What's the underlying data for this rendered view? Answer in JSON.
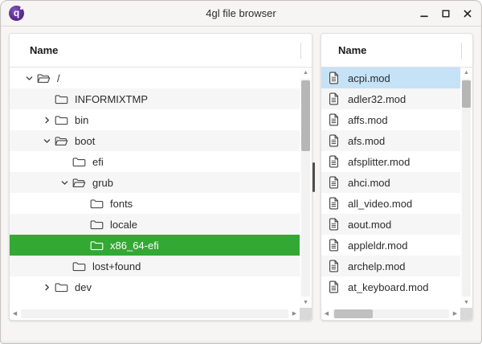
{
  "window": {
    "title": "4gl file browser",
    "icon_letter": "q",
    "controls": [
      "minimize",
      "maximize",
      "close"
    ]
  },
  "icons": {
    "up": "▲",
    "down": "▼",
    "left": "◀",
    "right": "▶",
    "names": [
      "app-logo-icon",
      "chevron-down-icon",
      "chevron-right-icon",
      "folder-closed-icon",
      "folder-open-icon",
      "file-document-icon",
      "minimize-icon",
      "maximize-icon",
      "close-icon",
      "scroll-up-icon",
      "scroll-down-icon",
      "scroll-left-icon",
      "scroll-right-icon"
    ]
  },
  "colors": {
    "tree_selection_green": "#34a834",
    "list_selection_blue": "#c5e2f7",
    "titlebar_bg": "#f6f5f4",
    "row_alt": "#f6f6f6",
    "app_icon_purple": "#5c2d91"
  },
  "left_panel": {
    "header": "Name",
    "tree": [
      {
        "label": "/",
        "level": 0,
        "state": "expanded",
        "folder": "open",
        "selected": false
      },
      {
        "label": "INFORMIXTMP",
        "level": 1,
        "state": "leaf",
        "folder": "closed",
        "selected": false
      },
      {
        "label": "bin",
        "level": 1,
        "state": "collapsed",
        "folder": "closed",
        "selected": false
      },
      {
        "label": "boot",
        "level": 1,
        "state": "expanded",
        "folder": "open",
        "selected": false
      },
      {
        "label": "efi",
        "level": 2,
        "state": "leaf",
        "folder": "closed",
        "selected": false
      },
      {
        "label": "grub",
        "level": 2,
        "state": "expanded",
        "folder": "open",
        "selected": false
      },
      {
        "label": "fonts",
        "level": 3,
        "state": "leaf",
        "folder": "closed",
        "selected": false
      },
      {
        "label": "locale",
        "level": 3,
        "state": "leaf",
        "folder": "closed",
        "selected": false
      },
      {
        "label": "x86_64-efi",
        "level": 3,
        "state": "leaf",
        "folder": "closed",
        "selected": true
      },
      {
        "label": "lost+found",
        "level": 2,
        "state": "leaf",
        "folder": "closed",
        "selected": false
      },
      {
        "label": "dev",
        "level": 1,
        "state": "collapsed",
        "folder": "closed",
        "selected": false
      }
    ]
  },
  "right_panel": {
    "header": "Name",
    "files": [
      {
        "label": "acpi.mod",
        "selected": true
      },
      {
        "label": "adler32.mod",
        "selected": false
      },
      {
        "label": "affs.mod",
        "selected": false
      },
      {
        "label": "afs.mod",
        "selected": false
      },
      {
        "label": "afsplitter.mod",
        "selected": false
      },
      {
        "label": "ahci.mod",
        "selected": false
      },
      {
        "label": "all_video.mod",
        "selected": false
      },
      {
        "label": "aout.mod",
        "selected": false
      },
      {
        "label": "appleldr.mod",
        "selected": false
      },
      {
        "label": "archelp.mod",
        "selected": false
      },
      {
        "label": "at_keyboard.mod",
        "selected": false
      }
    ]
  }
}
